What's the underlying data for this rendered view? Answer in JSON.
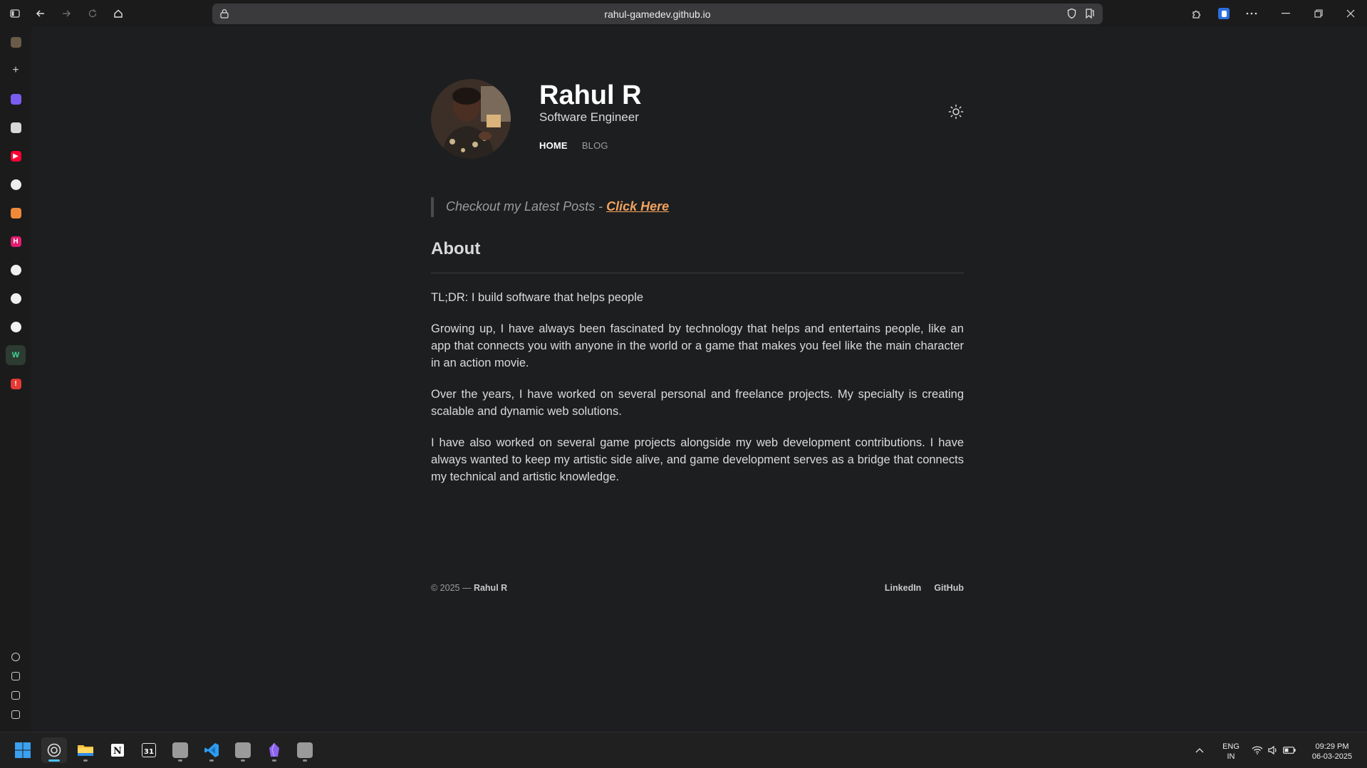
{
  "browser": {
    "url": "rahul-gamedev.github.io",
    "toolbar_icons": [
      "sidebar-toggle-icon",
      "back-icon",
      "forward-icon",
      "reload-icon",
      "home-icon"
    ],
    "address_icons": [
      "lock-icon",
      "shield-icon",
      "favorite-icon"
    ],
    "right_icons": [
      "extensions-icon",
      "profile-icon",
      "more-icon"
    ],
    "window_controls": [
      "minimize-icon",
      "restore-icon",
      "close-icon"
    ]
  },
  "sidebar": {
    "items": [
      {
        "name": "sidebar-app-1",
        "glyph": "",
        "color": "#6b5a4a"
      },
      {
        "name": "sidebar-add",
        "glyph": "+",
        "color": "transparent"
      },
      {
        "name": "sidebar-app-obsidian",
        "glyph": "",
        "color": "#7b5cf0"
      },
      {
        "name": "sidebar-app-unity",
        "glyph": "",
        "color": "#d8d8d8"
      },
      {
        "name": "sidebar-app-youtube",
        "glyph": "▶",
        "color": "#ff0033"
      },
      {
        "name": "sidebar-app-chrome",
        "glyph": "",
        "color": "#ededed"
      },
      {
        "name": "sidebar-app-orange",
        "glyph": "",
        "color": "#f08a3a"
      },
      {
        "name": "sidebar-app-hashnode",
        "glyph": "H",
        "color": "#e01c6f"
      },
      {
        "name": "sidebar-app-github-1",
        "glyph": "",
        "color": "#f0f0f0"
      },
      {
        "name": "sidebar-app-github-2",
        "glyph": "",
        "color": "#f0f0f0"
      },
      {
        "name": "sidebar-app-github-3",
        "glyph": "",
        "color": "#f0f0f0"
      },
      {
        "name": "sidebar-app-webflow",
        "glyph": "W",
        "color": "#2d3b33"
      },
      {
        "name": "sidebar-app-alert",
        "glyph": "!",
        "color": "#e53935"
      }
    ],
    "bottom_items": [
      "settings-icon",
      "profile-app-icon",
      "wallet-icon",
      "download-icon"
    ]
  },
  "page": {
    "name": "Rahul R",
    "role": "Software Engineer",
    "nav": [
      {
        "label": "HOME",
        "active": true
      },
      {
        "label": "BLOG",
        "active": false
      }
    ],
    "quote_text": "Checkout my Latest Posts - ",
    "quote_link": "Click Here",
    "about_heading": "About",
    "paragraphs": [
      "TL;DR: I build software that helps people",
      "Growing up, I have always been fascinated by technology that helps and entertains people, like an app that connects you with anyone in the world or a game that makes you feel like the main character in an action movie.",
      "Over the years, I have worked on several personal and freelance projects. My specialty is creating scalable and dynamic web solutions.",
      "I have also worked on several game projects alongside my web development contributions. I have always wanted to keep my artistic side alive, and game development serves as a bridge that connects my technical and artistic knowledge."
    ],
    "footer": {
      "copyright": "© 2025 — ",
      "owner": "Rahul R",
      "links": [
        "LinkedIn",
        "GitHub"
      ]
    }
  },
  "taskbar": {
    "apps": [
      "start-icon",
      "browser-app-icon",
      "file-explorer-icon",
      "notion-icon",
      "calendar-icon",
      "app-icon-grey-1",
      "vscode-icon",
      "app-icon-grey-2",
      "obsidian-icon",
      "app-icon-grey-3"
    ],
    "calendar_glyph": "31",
    "lang_top": "ENG",
    "lang_bottom": "IN",
    "time": "09:29 PM",
    "date": "06-03-2025"
  },
  "colors": {
    "background": "#1d1e20",
    "text": "#dadadb",
    "secondary": "#9b9c9d",
    "accent_link": "#f2a35f"
  }
}
